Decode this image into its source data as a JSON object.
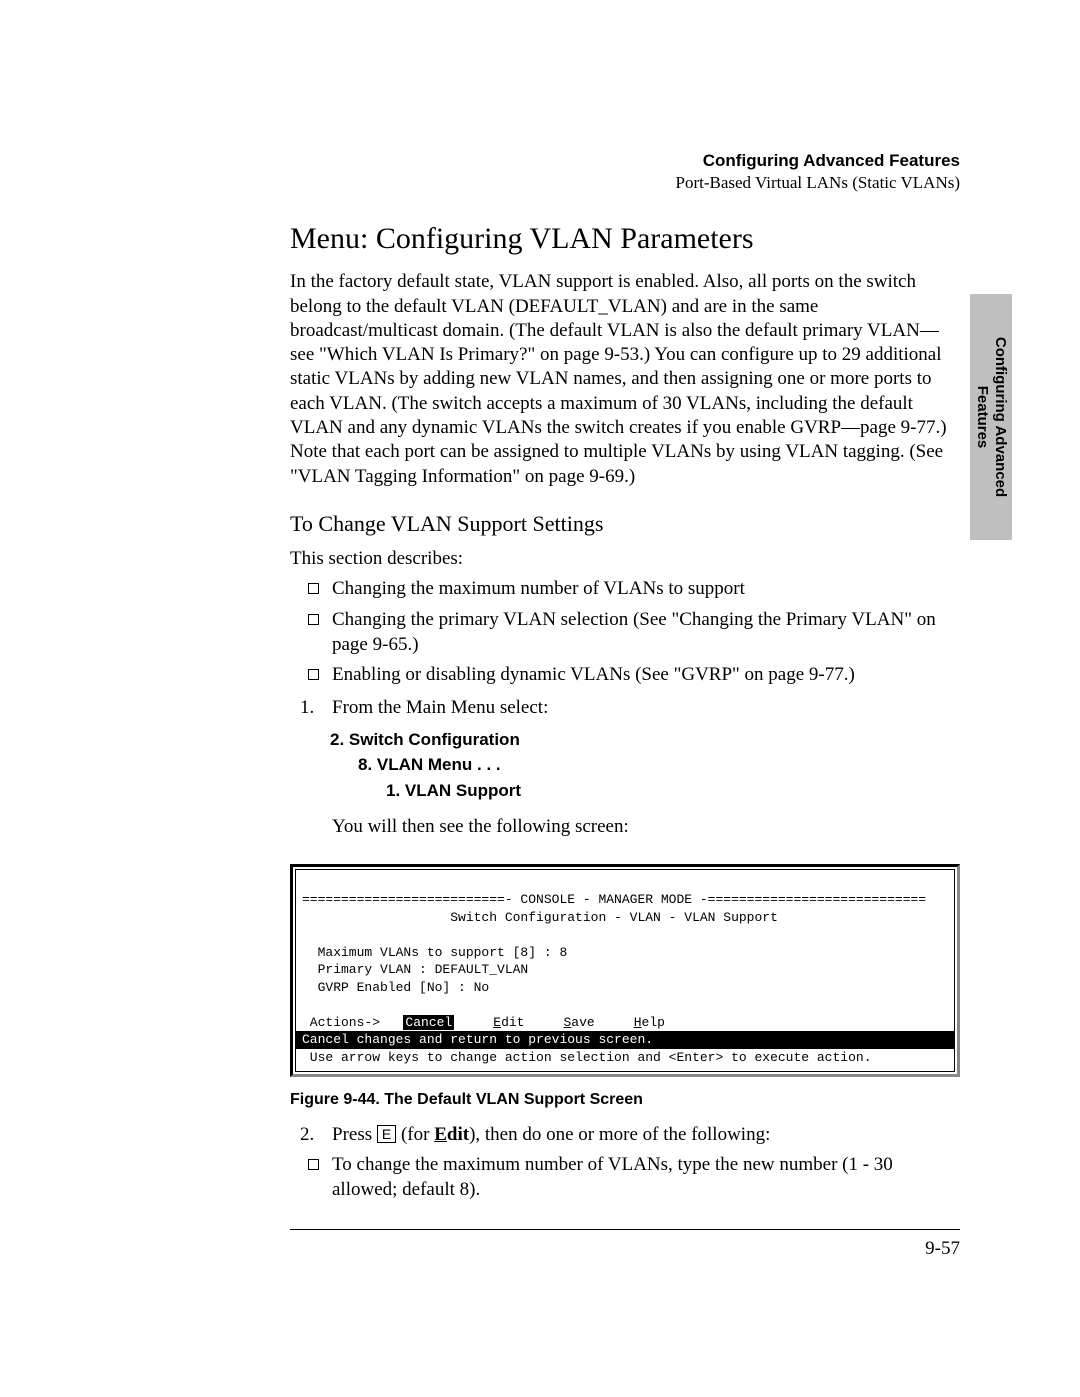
{
  "header": {
    "bold": "Configuring Advanced Features",
    "sub": "Port-Based Virtual LANs (Static VLANs)"
  },
  "sideTab": {
    "line1": "Configuring Advanced",
    "line2": "Features"
  },
  "heading": "Menu: Configuring VLAN Parameters",
  "intro": "In the factory default state, VLAN support is enabled. Also, all ports on the switch belong to the default VLAN (DEFAULT_VLAN) and are in the same broadcast/multicast domain.  (The default VLAN is also the default primary VLAN—see \"Which VLAN Is Primary?\" on page 9-53.) You can configure up to 29 additional static VLANs by adding new VLAN names, and then assigning one or more ports to each VLAN. (The switch accepts a maximum of 30 VLANs, including the default VLAN and any dynamic VLANs the switch creates if you enable GVRP—page 9-77.) Note that each port can be assigned to multiple VLANs by using VLAN tagging. (See \"VLAN Tagging Information\" on page 9-69.)",
  "subheading": "To Change VLAN Support Settings",
  "lead": "This section describes:",
  "bullets1": [
    "Changing the maximum number of VLANs to support",
    "Changing the primary VLAN selection (See \"Changing the Primary VLAN\" on page 9-65.)",
    "Enabling or disabling dynamic VLANs (See \"GVRP\" on page 9-77.)"
  ],
  "step1": {
    "num": "1.",
    "text": "From the Main Menu select:"
  },
  "menuPath": {
    "l1": "2. Switch Configuration",
    "l2": "8. VLAN Menu . . .",
    "l3": "1. VLAN Support"
  },
  "afterMenu": "You will then see the following screen:",
  "console": {
    "banner": "==========================- CONSOLE - MANAGER MODE -============================",
    "subtitle": "                   Switch Configuration - VLAN - VLAN Support",
    "lines": [
      "  Maximum VLANs to support [8] : 8",
      "  Primary VLAN : DEFAULT_VLAN",
      "  GVRP Enabled [No] : No"
    ],
    "actionsLabel": " Actions->",
    "cancel": "Cancel",
    "edit_u": "E",
    "edit_rest": "dit",
    "save_u": "S",
    "save_rest": "ave",
    "help_u": "H",
    "help_rest": "elp",
    "barText": "Cancel changes and return to previous screen.",
    "hintText": " Use arrow keys to change action selection and <Enter> to execute action."
  },
  "figureCaption": "Figure 9-44.  The Default VLAN Support Screen",
  "step2": {
    "num": "2.",
    "pre": "Press ",
    "key": "E",
    "mid": " (for ",
    "editU": "E",
    "editRest": "dit",
    "post": "), then do one or more of the following:"
  },
  "bullets2": [
    "To change the maximum number of VLANs, type the new number (1 - 30 allowed; default 8)."
  ],
  "pageNumber": "9-57"
}
